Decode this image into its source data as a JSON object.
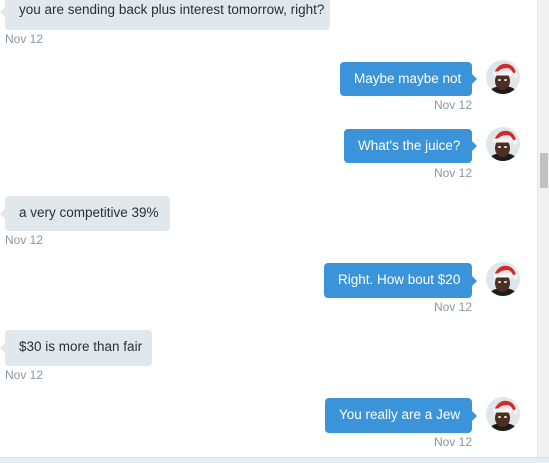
{
  "conversation": {
    "messages": [
      {
        "direction": "in",
        "text": "you are sending back plus interest tomorrow, right?",
        "time": "Nov 12"
      },
      {
        "direction": "out",
        "text": "Maybe maybe not",
        "time": "Nov 12"
      },
      {
        "direction": "out",
        "text": "What's the juice?",
        "time": "Nov 12"
      },
      {
        "direction": "in",
        "text": "a very competitive 39%",
        "time": "Nov 12"
      },
      {
        "direction": "out",
        "text": "Right. How bout $20",
        "time": "Nov 12"
      },
      {
        "direction": "in",
        "text": "$30 is more than fair",
        "time": "Nov 12"
      },
      {
        "direction": "out",
        "text": "You really are a Jew",
        "time": "Nov 12"
      }
    ]
  },
  "colors": {
    "outgoing_bubble": "#3b94d9",
    "incoming_bubble": "#e1e8ed",
    "timestamp": "#8899a6"
  },
  "icons": {
    "avatar": "user-avatar-santa-hat"
  }
}
